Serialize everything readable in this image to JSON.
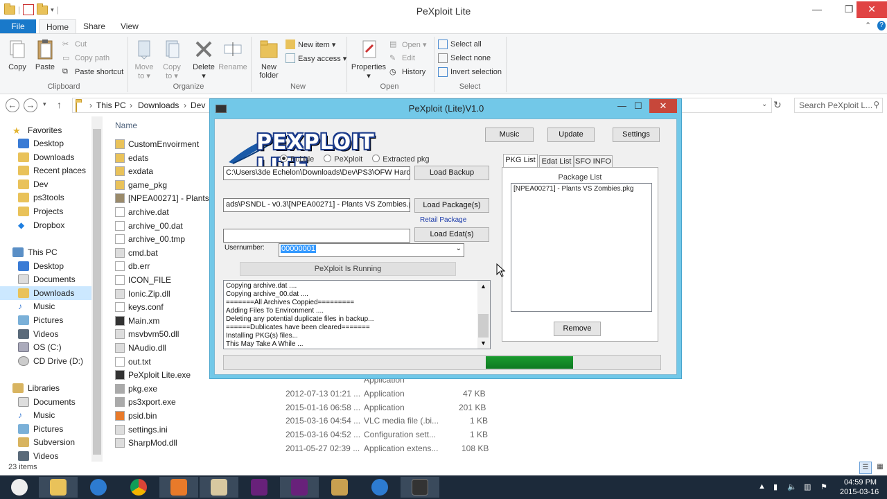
{
  "explorer": {
    "window_title": "PeXploit Lite",
    "tabs": {
      "file": "File",
      "home": "Home",
      "share": "Share",
      "view": "View"
    },
    "ribbon": {
      "clipboard": {
        "copy": "Copy",
        "paste": "Paste",
        "cut": "Cut",
        "copy_path": "Copy path",
        "paste_shortcut": "Paste shortcut",
        "label": "Clipboard"
      },
      "organize": {
        "move_to": "Move",
        "move_to2": "to ▾",
        "copy_to": "Copy",
        "copy_to2": "to ▾",
        "delete": "Delete",
        "delete2": "▾",
        "rename": "Rename",
        "label": "Organize"
      },
      "new": {
        "new_folder": "New",
        "new_folder2": "folder",
        "new_item": "New item ▾",
        "easy_access": "Easy access ▾",
        "label": "New"
      },
      "open": {
        "properties": "Properties",
        "properties2": "▾",
        "open": "Open ▾",
        "edit": "Edit",
        "history": "History",
        "label": "Open"
      },
      "select": {
        "select_all": "Select all",
        "select_none": "Select none",
        "invert": "Invert selection",
        "label": "Select"
      }
    },
    "breadcrumb": [
      "This PC",
      "Downloads",
      "Dev"
    ],
    "search_placeholder": "Search PeXploit L...",
    "nav": {
      "favorites": "Favorites",
      "fav_items": [
        "Desktop",
        "Downloads",
        "Recent places",
        "Dev",
        "ps3tools",
        "Projects",
        "Dropbox"
      ],
      "this_pc": "This PC",
      "pc_items": [
        "Desktop",
        "Documents",
        "Downloads",
        "Music",
        "Pictures",
        "Videos",
        "OS (C:)",
        "CD Drive (D:)"
      ],
      "libraries": "Libraries",
      "lib_items": [
        "Documents",
        "Music",
        "Pictures",
        "Subversion",
        "Videos"
      ]
    },
    "column_name": "Name",
    "files": [
      "CustomEnvoirment",
      "edats",
      "exdata",
      "game_pkg",
      "[NPEA00271] - Plants V",
      "archive.dat",
      "archive_00.dat",
      "archive_00.tmp",
      "cmd.bat",
      "db.err",
      "ICON_FILE",
      "Ionic.Zip.dll",
      "keys.conf",
      "Main.xm",
      "msvbvm50.dll",
      "NAudio.dll",
      "out.txt",
      "PeXploit Lite.exe",
      "pkg.exe",
      "ps3xport.exe",
      "psid.bin",
      "settings.ini",
      "SharpMod.dll"
    ],
    "file_details": [
      {
        "date": "",
        "type": "Application",
        "size": ""
      },
      {
        "date": "2012-07-13 01:21 ...",
        "type": "Application",
        "size": "47 KB"
      },
      {
        "date": "2015-01-16 06:58 ...",
        "type": "Application",
        "size": "201 KB"
      },
      {
        "date": "2015-03-16 04:54 ...",
        "type": "VLC media file (.bi...",
        "size": "1 KB"
      },
      {
        "date": "2015-03-16 04:52 ...",
        "type": "Configuration sett...",
        "size": "1 KB"
      },
      {
        "date": "2011-05-27 02:39 ...",
        "type": "Application extens...",
        "size": "108 KB"
      }
    ],
    "status": "23 items"
  },
  "dialog": {
    "title": "PeXploit (Lite)V1.0",
    "logo_text": "PEXPLOIT LITE",
    "buttons": {
      "music": "Music",
      "update": "Update",
      "settings": "Settings",
      "load_backup": "Load Backup",
      "load_packages": "Load Package(s)",
      "load_edats": "Load Edat(s)",
      "remove": "Remove"
    },
    "radios": [
      {
        "label": "Bubble",
        "checked": true
      },
      {
        "label": "PeXploit",
        "checked": false
      },
      {
        "label": "Extracted pkg",
        "checked": false
      }
    ],
    "backup_path": "C:\\Users\\3de Echelon\\Downloads\\Dev\\PS3\\OFW Hardriv",
    "package_path": "ads\\PSNDL - v0.3\\[NPEA00271] - Plants VS Zombies.pkg",
    "retail_label": "Retail Package",
    "edat_path": "",
    "usernumber_label": "Usernumber:",
    "usernumber_value": "00000001",
    "running_label": "PeXploit Is Running",
    "log_lines": [
      "Copying archive.dat ....",
      "Copying archive_00.dat ....",
      "=======All Archives Coppied=========",
      "Adding Files To Environment ....",
      "Deleting any potential duplicate files in backup...",
      "======Dublicates have been cleared=======",
      "Installing PKG(s) files...",
      "This May Take A While ..."
    ],
    "right_tabs": [
      "PKG List",
      "Edat List",
      "SFO INFO"
    ],
    "package_list_label": "Package List",
    "package_items": [
      "[NPEA00271] - Plants VS Zombies.pkg"
    ],
    "progress": {
      "start_fraction": 0.6,
      "end_fraction": 0.8
    }
  },
  "taskbar": {
    "time": "04:59 PM",
    "date": "2015-03-16"
  }
}
